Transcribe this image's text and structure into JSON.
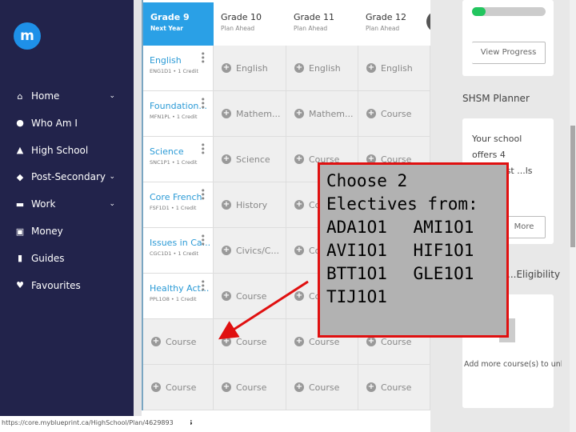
{
  "sidebar": {
    "logo": "m",
    "items": [
      {
        "label": "Home",
        "icon": "home-icon",
        "chev": true
      },
      {
        "label": "Who Am I",
        "icon": "compass-icon",
        "chev": false
      },
      {
        "label": "High School",
        "icon": "school-icon",
        "chev": false
      },
      {
        "label": "Post-Secondary",
        "icon": "graduation-cap-icon",
        "chev": true
      },
      {
        "label": "Work",
        "icon": "briefcase-icon",
        "chev": true
      },
      {
        "label": "Money",
        "icon": "money-icon",
        "chev": false
      },
      {
        "label": "Guides",
        "icon": "book-icon",
        "chev": false
      },
      {
        "label": "Favourites",
        "icon": "heart-icon",
        "chev": false
      }
    ]
  },
  "grades": [
    {
      "title": "Grade 9",
      "sub": "Next Year"
    },
    {
      "title": "Grade 10",
      "sub": "Plan Ahead"
    },
    {
      "title": "Grade 11",
      "sub": "Plan Ahead"
    },
    {
      "title": "Grade 12",
      "sub": "Plan Ahead"
    }
  ],
  "grade9_courses": [
    {
      "name": "English",
      "code": "ENG1D1 • 1 Credit"
    },
    {
      "name": "Foundation...",
      "code": "MFN1PL • 1 Credit"
    },
    {
      "name": "Science",
      "code": "SNC1P1 • 1 Credit"
    },
    {
      "name": "Core French",
      "code": "FSF1D1 • 1 Credit"
    },
    {
      "name": "Issues in Ca...",
      "code": "CGC1D1 • 1 Credit"
    },
    {
      "name": "Healthy Act...",
      "code": "PPL1O8 • 1 Credit"
    }
  ],
  "grade9_empty": [
    "Course",
    "Course"
  ],
  "grade10": [
    "English",
    "Mathem...",
    "Science",
    "History",
    "Civics/C...",
    "Course",
    "Course",
    "Course"
  ],
  "grade11": [
    "English",
    "Mathem...",
    "Course",
    "Course",
    "Course",
    "Course",
    "Course",
    "Course"
  ],
  "grade12": [
    "English",
    "Course",
    "Course",
    "Course",
    "Course",
    "Course",
    "Course",
    "Course"
  ],
  "right_panel": {
    "progress": 0.1,
    "progress_color": "#22c55e",
    "view_progress": "View Progress",
    "shsm_title": "SHSM Planner",
    "shsm_text": "Your school offers 4 Specialist ...ls",
    "more": "More",
    "eligibility_title": "...Eligibility",
    "eligibility_text": "Add more course(s) to unlo... Post-Secondary Eligiblity"
  },
  "callout": {
    "heading": "Choose 2 Electives from:",
    "codes": [
      "ADA1O1",
      "AMI1O1",
      "AVI1O1",
      "HIF1O1",
      "BTT1O1",
      "GLE1O1",
      "TIJ1O1"
    ]
  },
  "status_url": "https://core.myblueprint.ca/HighSchool/Plan/4629893",
  "bottom_fragment": "s"
}
